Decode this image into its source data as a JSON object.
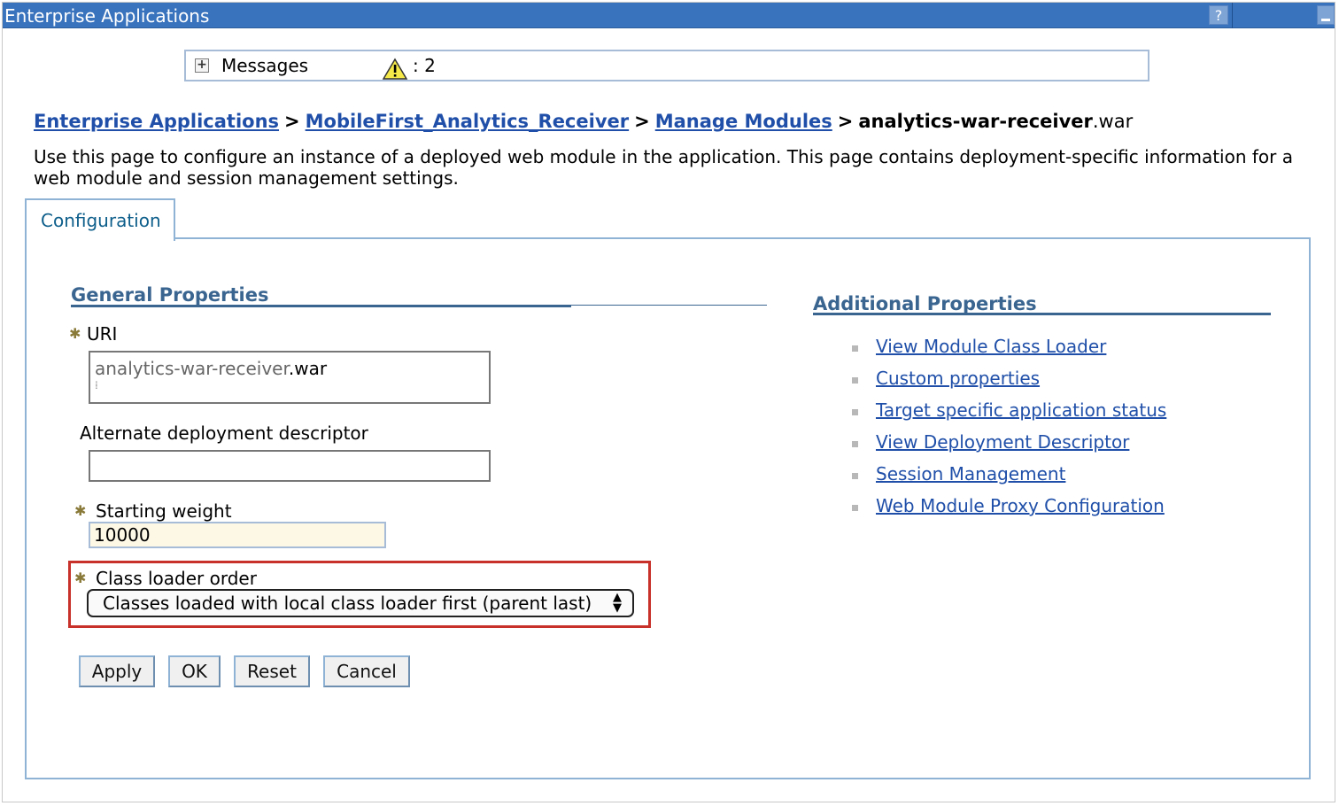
{
  "window": {
    "title": "Enterprise Applications",
    "help_label": "?"
  },
  "messages": {
    "label": "Messages",
    "count": ": 2"
  },
  "breadcrumb": {
    "items": [
      "Enterprise Applications",
      "MobileFirst_Analytics_Receiver",
      "Manage Modules"
    ],
    "separator": ">",
    "current": "analytics-war-receiver",
    "current_ext": ".war"
  },
  "description": "Use this page to configure an instance of a deployed web module in the application. This page contains deployment-specific information for a web module and session management settings.",
  "tab": {
    "label": "Configuration"
  },
  "general": {
    "heading": "General Properties",
    "uri_label": "URI",
    "uri_value": "analytics-war-receiver",
    "uri_ext": ".war",
    "alt_label": "Alternate deployment descriptor",
    "alt_value": "",
    "weight_label": "Starting weight",
    "weight_value": "10000",
    "class_loader_label": "Class loader order",
    "class_loader_value": "Classes loaded with local class loader first (parent last)"
  },
  "buttons": {
    "apply": "Apply",
    "ok": "OK",
    "reset": "Reset",
    "cancel": "Cancel"
  },
  "additional": {
    "heading": "Additional Properties",
    "links": [
      "View Module Class Loader",
      "Custom properties",
      "Target specific application status",
      "View Deployment Descriptor",
      "Session Management",
      "Web Module Proxy Configuration"
    ]
  },
  "colors": {
    "titlebar": "#3a73bd",
    "link": "#1f4fa8",
    "heading": "#3a6590",
    "highlight": "#c8302a"
  }
}
